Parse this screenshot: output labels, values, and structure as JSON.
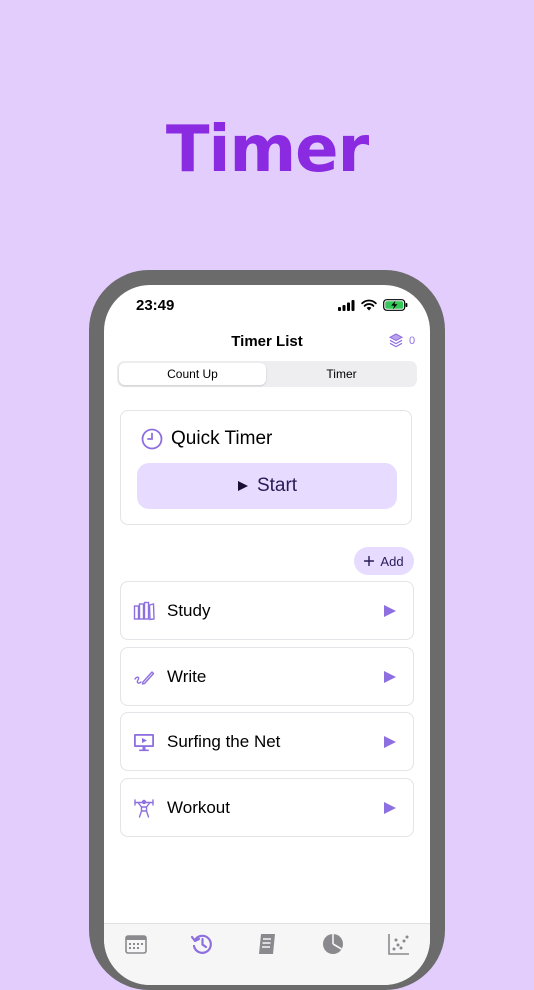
{
  "hero": {
    "title": "Timer"
  },
  "status_bar": {
    "time": "23:49"
  },
  "nav": {
    "title": "Timer List",
    "layers_count": "0"
  },
  "segmented": {
    "count_up": "Count Up",
    "timer": "Timer",
    "selected": "Count Up"
  },
  "quick_timer": {
    "title": "Quick Timer",
    "start_label": "Start",
    "icon": "clock-icon"
  },
  "add_button": {
    "label": "Add"
  },
  "timers": [
    {
      "label": "Study",
      "icon": "books-icon"
    },
    {
      "label": "Write",
      "icon": "pen-icon"
    },
    {
      "label": "Surfing the Net",
      "icon": "monitor-icon"
    },
    {
      "label": "Workout",
      "icon": "weightlifter-icon"
    }
  ],
  "tab_bar": {
    "tabs": [
      "calendar-icon",
      "history-icon",
      "notes-icon",
      "pie-chart-icon",
      "scatter-chart-icon"
    ],
    "selected": "history-icon"
  },
  "colors": {
    "background": "#e2cdfd",
    "hero_title": "#8a2be2",
    "accent": "#8e6fe0",
    "button_bg": "#e7dbff",
    "phone_frame": "#6b6b6b"
  }
}
